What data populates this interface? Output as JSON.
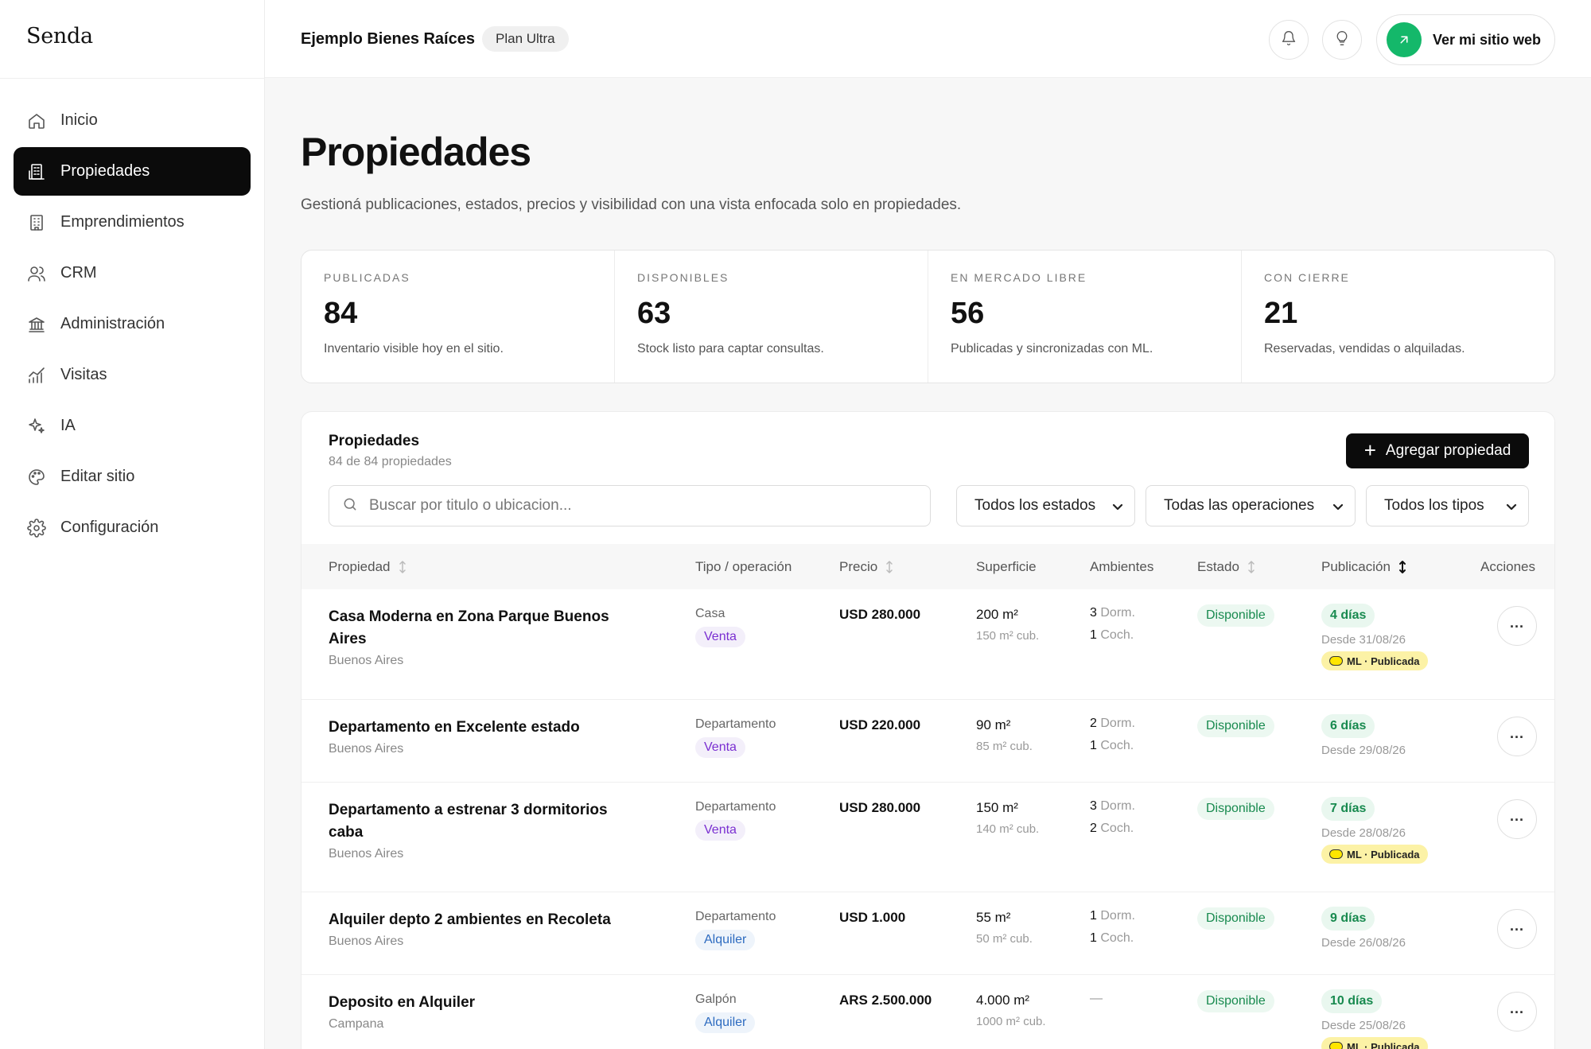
{
  "brand": "Senda",
  "sidebar": {
    "items": [
      {
        "label": "Inicio",
        "icon": "home-icon",
        "active": false
      },
      {
        "label": "Propiedades",
        "icon": "building-icon",
        "active": true
      },
      {
        "label": "Emprendimientos",
        "icon": "office-icon",
        "active": false
      },
      {
        "label": "CRM",
        "icon": "users-icon",
        "active": false
      },
      {
        "label": "Administración",
        "icon": "bank-icon",
        "active": false
      },
      {
        "label": "Visitas",
        "icon": "chart-icon",
        "active": false
      },
      {
        "label": "IA",
        "icon": "sparkles-icon",
        "active": false
      },
      {
        "label": "Editar sitio",
        "icon": "palette-icon",
        "active": false
      },
      {
        "label": "Configuración",
        "icon": "gear-icon",
        "active": false
      }
    ]
  },
  "header": {
    "company": "Ejemplo Bienes Raíces",
    "plan": "Plan Ultra",
    "site_button": "Ver mi sitio web"
  },
  "page": {
    "title": "Propiedades",
    "subtitle": "Gestioná publicaciones, estados, precios y visibilidad con una vista enfocada solo en propiedades."
  },
  "stats": [
    {
      "key": "PUBLICADAS",
      "value": "84",
      "desc": "Inventario visible hoy en el sitio."
    },
    {
      "key": "DISPONIBLES",
      "value": "63",
      "desc": "Stock listo para captar consultas."
    },
    {
      "key": "EN MERCADO LIBRE",
      "value": "56",
      "desc": "Publicadas y sincronizadas con ML."
    },
    {
      "key": "CON CIERRE",
      "value": "21",
      "desc": "Reservadas, vendidas o alquiladas."
    }
  ],
  "list": {
    "title": "Propiedades",
    "count": "84 de 84 propiedades",
    "add_button": "Agregar propiedad",
    "search_placeholder": "Buscar por titulo o ubicacion...",
    "filters": {
      "estado": "Todos los estados",
      "operacion": "Todas las operaciones",
      "tipo": "Todos los tipos"
    },
    "columns": {
      "propiedad": "Propiedad",
      "tipo": "Tipo / operación",
      "precio": "Precio",
      "superficie": "Superficie",
      "ambientes": "Ambientes",
      "estado": "Estado",
      "publicacion": "Publicación",
      "acciones": "Acciones"
    },
    "rows": [
      {
        "title": "Casa Moderna en Zona Parque Buenos Aires",
        "location": "Buenos Aires",
        "tipo": "Casa",
        "operacion": "Venta",
        "precio": "USD 280.000",
        "sup": "200 m²",
        "sup_cub": "150 m² cub.",
        "dorm": "3",
        "dorm_label": "Dorm.",
        "coch": "1",
        "coch_label": "Coch.",
        "estado": "Disponible",
        "dias": "4 días",
        "desde": "Desde 31/08/26",
        "ml": "ML · Publicada"
      },
      {
        "title": "Departamento en Excelente estado",
        "location": "Buenos Aires",
        "tipo": "Departamento",
        "operacion": "Venta",
        "precio": "USD 220.000",
        "sup": "90 m²",
        "sup_cub": "85 m² cub.",
        "dorm": "2",
        "dorm_label": "Dorm.",
        "coch": "1",
        "coch_label": "Coch.",
        "estado": "Disponible",
        "dias": "6 días",
        "desde": "Desde 29/08/26",
        "ml": ""
      },
      {
        "title": "Departamento a estrenar 3 dormitorios caba",
        "location": "Buenos Aires",
        "tipo": "Departamento",
        "operacion": "Venta",
        "precio": "USD 280.000",
        "sup": "150 m²",
        "sup_cub": "140 m² cub.",
        "dorm": "3",
        "dorm_label": "Dorm.",
        "coch": "2",
        "coch_label": "Coch.",
        "estado": "Disponible",
        "dias": "7 días",
        "desde": "Desde 28/08/26",
        "ml": "ML · Publicada"
      },
      {
        "title": "Alquiler depto 2 ambientes en Recoleta",
        "location": "Buenos Aires",
        "tipo": "Departamento",
        "operacion": "Alquiler",
        "precio": "USD 1.000",
        "sup": "55 m²",
        "sup_cub": "50 m² cub.",
        "dorm": "1",
        "dorm_label": "Dorm.",
        "coch": "1",
        "coch_label": "Coch.",
        "estado": "Disponible",
        "dias": "9 días",
        "desde": "Desde 26/08/26",
        "ml": ""
      },
      {
        "title": "Deposito en Alquiler",
        "location": "Campana",
        "tipo": "Galpón",
        "operacion": "Alquiler",
        "precio": "ARS 2.500.000",
        "sup": "4.000 m²",
        "sup_cub": "1000 m² cub.",
        "dorm": "",
        "dorm_label": "—",
        "coch": "",
        "coch_label": "",
        "estado": "Disponible",
        "dias": "10 días",
        "desde": "Desde 25/08/26",
        "ml": "ML · Publicada"
      }
    ]
  }
}
